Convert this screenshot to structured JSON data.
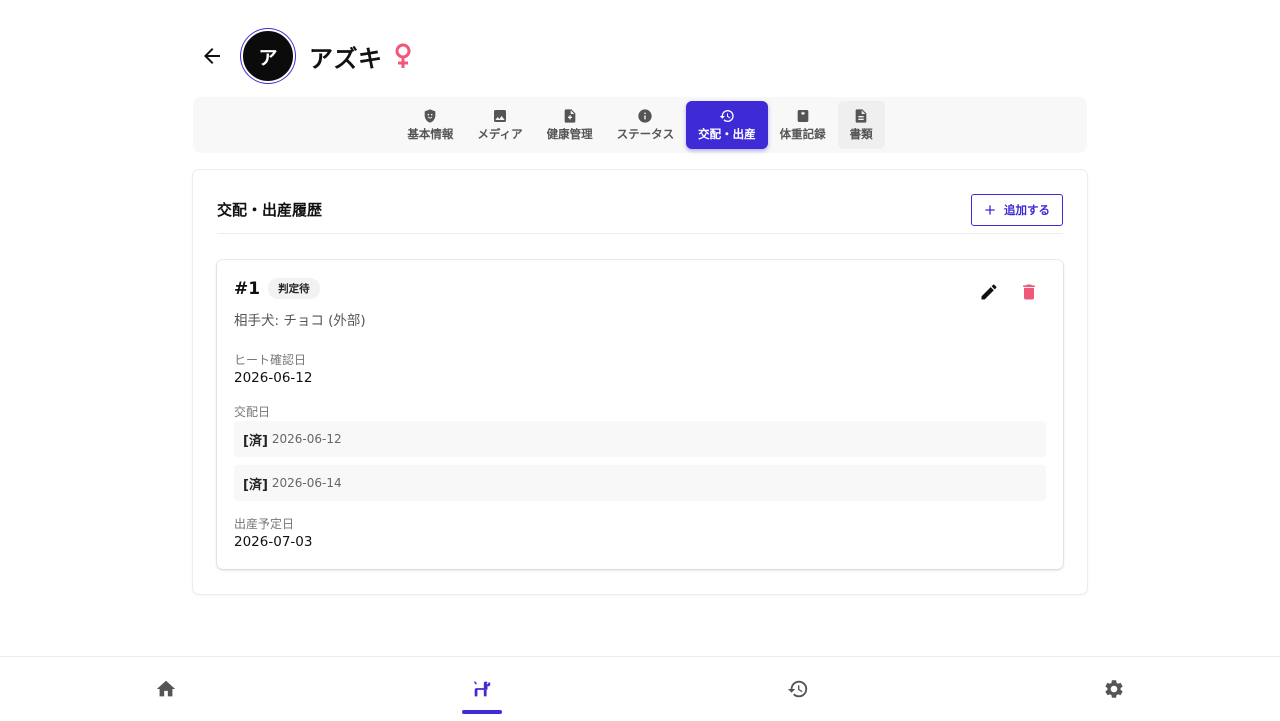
{
  "header": {
    "avatar_initial": "ア",
    "pet_name": "アズキ",
    "sex_icon": "female-icon",
    "sex_color": "#f0587a"
  },
  "tabs": [
    {
      "label": "基本情報",
      "icon": "shield-pet-icon",
      "active": false
    },
    {
      "label": "メディア",
      "icon": "image-icon",
      "active": false
    },
    {
      "label": "健康管理",
      "icon": "medical-file-icon",
      "active": false
    },
    {
      "label": "ステータス",
      "icon": "info-icon",
      "active": false
    },
    {
      "label": "交配・出産",
      "icon": "history-icon",
      "active": true
    },
    {
      "label": "体重記録",
      "icon": "weight-icon",
      "active": false
    },
    {
      "label": "書類",
      "icon": "document-icon",
      "active": false
    }
  ],
  "section": {
    "title": "交配・出産履歴",
    "add_label": "追加する"
  },
  "record": {
    "number": "#1",
    "status": "判定待",
    "partner": "相手犬: チョコ (外部)",
    "heat_label": "ヒート確認日",
    "heat_date": "2026-06-12",
    "mating_label": "交配日",
    "matings": [
      {
        "status": "[済]",
        "date": "2026-06-12"
      },
      {
        "status": "[済]",
        "date": "2026-06-14"
      }
    ],
    "due_label": "出産予定日",
    "due_date": "2026-07-03"
  },
  "bottom_nav": [
    {
      "icon": "home-icon",
      "active": false
    },
    {
      "icon": "dog-icon",
      "active": true
    },
    {
      "icon": "history-icon",
      "active": false
    },
    {
      "icon": "settings-icon",
      "active": false
    }
  ],
  "colors": {
    "accent": "#3e2bd6",
    "delete": "#f0587a"
  }
}
